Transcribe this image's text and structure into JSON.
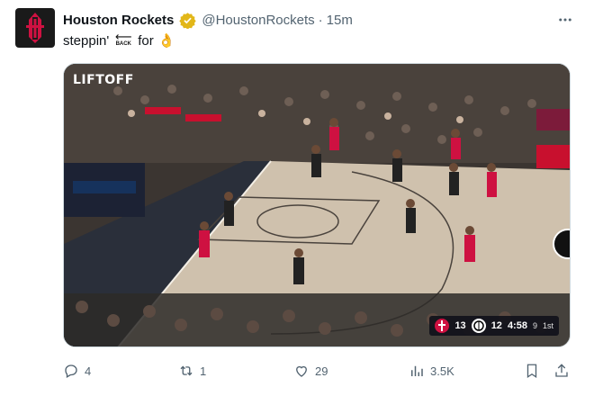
{
  "tweet": {
    "display_name": "Houston Rockets",
    "handle": "@HoustonRockets",
    "separator": "·",
    "time": "15m",
    "text_before": "steppin'",
    "back_emoji_text": "BACK",
    "text_after": "for",
    "ok_emoji": "👌"
  },
  "media": {
    "brand": "LIFTOFF",
    "scorebug": {
      "home_score": "13",
      "away_score": "12",
      "clock": "4:58",
      "shot_clock": "9",
      "quarter": "1st"
    }
  },
  "actions": {
    "replies": "4",
    "reposts": "1",
    "likes": "29",
    "views": "3.5K"
  },
  "colors": {
    "accent": "#1d9bf0",
    "verified": "#e2b719",
    "muted": "#536471",
    "rockets_red": "#ce1141"
  },
  "icons": [
    "verified-badge-icon",
    "more-icon",
    "reply-icon",
    "repost-icon",
    "like-icon",
    "views-icon",
    "bookmark-icon",
    "share-icon"
  ]
}
